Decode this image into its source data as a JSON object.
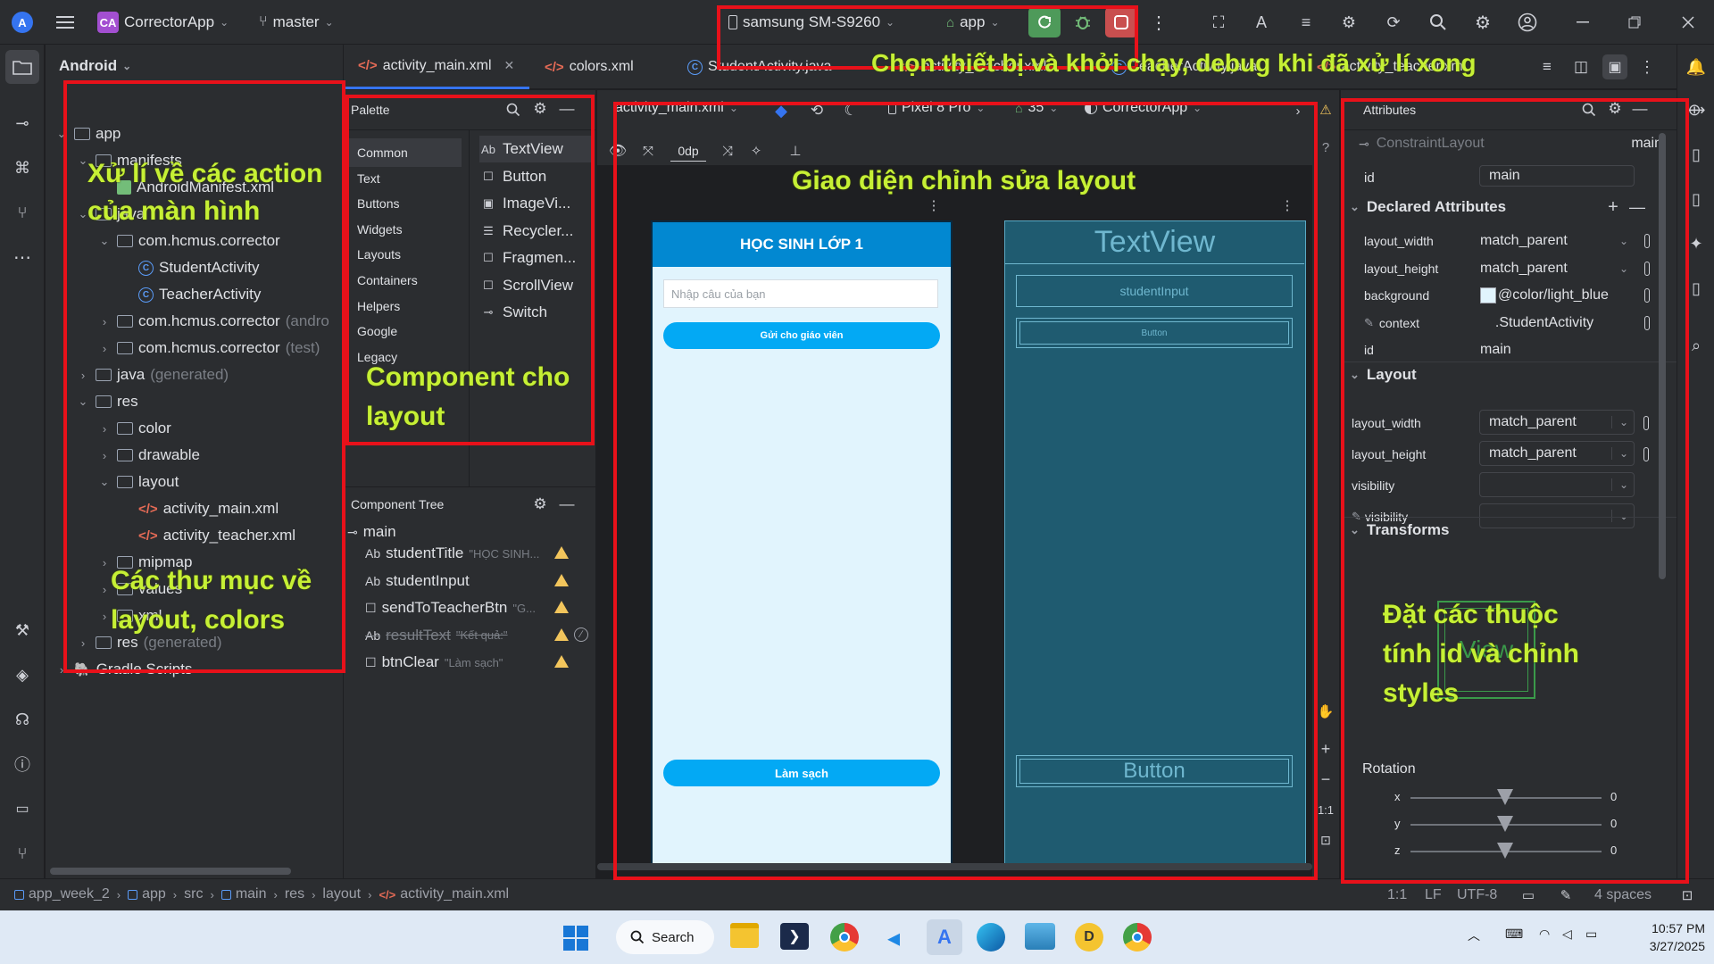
{
  "titlebar": {
    "app_badge": "CA",
    "project_name": "CorrectorApp",
    "branch": "master",
    "device": "samsung SM-S9260",
    "run_config": "app",
    "window_controls": [
      "minimize-icon",
      "restore-icon",
      "close-icon"
    ]
  },
  "project_panel": {
    "view_mode": "Android",
    "items": [
      {
        "label": "app",
        "type": "folder",
        "depth": 0,
        "expanded": true
      },
      {
        "label": "manifests",
        "type": "folder",
        "depth": 1,
        "expanded": true
      },
      {
        "label": "AndroidManifest.xml",
        "type": "manifest",
        "depth": 2
      },
      {
        "label": "java",
        "type": "folder",
        "depth": 1,
        "expanded": true
      },
      {
        "label": "com.hcmus.corrector",
        "type": "package",
        "depth": 2,
        "expanded": true
      },
      {
        "label": "StudentActivity",
        "type": "class",
        "depth": 3
      },
      {
        "label": "TeacherActivity",
        "type": "class",
        "depth": 3
      },
      {
        "label": "com.hcmus.corrector",
        "suffix": "(andro",
        "type": "package",
        "depth": 2
      },
      {
        "label": "com.hcmus.corrector",
        "suffix": "(test)",
        "type": "package",
        "depth": 2
      },
      {
        "label": "java",
        "suffix": "(generated)",
        "type": "folder",
        "depth": 1
      },
      {
        "label": "res",
        "type": "folder",
        "depth": 1,
        "expanded": true
      },
      {
        "label": "color",
        "type": "folder",
        "depth": 2
      },
      {
        "label": "drawable",
        "type": "folder",
        "depth": 2
      },
      {
        "label": "layout",
        "type": "folder",
        "depth": 2,
        "expanded": true
      },
      {
        "label": "activity_main.xml",
        "type": "xml",
        "depth": 3,
        "selected": true
      },
      {
        "label": "activity_teacher.xml",
        "type": "xml",
        "depth": 3
      },
      {
        "label": "mipmap",
        "type": "folder",
        "depth": 2
      },
      {
        "label": "values",
        "type": "folder",
        "depth": 2
      },
      {
        "label": "xml",
        "type": "folder",
        "depth": 2
      },
      {
        "label": "res",
        "suffix": "(generated)",
        "type": "folder",
        "depth": 1
      },
      {
        "label": "Gradle Scripts",
        "type": "gradle",
        "depth": 0
      }
    ]
  },
  "editor_tabs": [
    {
      "label": "activity_main.xml",
      "active": true,
      "closable": true
    },
    {
      "label": "colors.xml"
    },
    {
      "label": "StudentActivity.java"
    },
    {
      "label": "activity_teacher.xml"
    },
    {
      "label": "TeacherActivity.java"
    },
    {
      "label": "activity_teacher.xml"
    }
  ],
  "palette": {
    "title": "Palette",
    "categories": [
      "Common",
      "Text",
      "Buttons",
      "Widgets",
      "Layouts",
      "Containers",
      "Helpers",
      "Google",
      "Legacy"
    ],
    "items": [
      {
        "icon": "Ab",
        "label": "TextView"
      },
      {
        "icon": "☐",
        "label": "Button"
      },
      {
        "icon": "▣",
        "label": "ImageVi..."
      },
      {
        "icon": "☰",
        "label": "Recycler..."
      },
      {
        "icon": "☐",
        "label": "Fragmen..."
      },
      {
        "icon": "☐",
        "label": "ScrollView"
      },
      {
        "icon": "⊸",
        "label": "Switch"
      }
    ]
  },
  "component_tree": {
    "title": "Component Tree",
    "root": "main",
    "items": [
      {
        "icon": "Ab",
        "label": "studentTitle",
        "sub": "\"HỌC SINH...",
        "warn": true
      },
      {
        "icon": "Ab",
        "label": "studentInput",
        "sub": "",
        "warn": true
      },
      {
        "icon": "☐",
        "label": "sendToTeacherBtn",
        "sub": "\"G...",
        "warn": true
      },
      {
        "icon": "Ab",
        "label": "resultText",
        "sub": "\"Kết quả:\"",
        "warn": true,
        "disabled": true
      },
      {
        "icon": "☐",
        "label": "btnClear",
        "sub": "\"Làm sạch\"",
        "warn": true
      }
    ]
  },
  "design_toolbar": {
    "file": "activity_main.xml",
    "device": "Pixel 8 Pro",
    "api": "35",
    "theme": "CorrectorApp",
    "margin": "0dp"
  },
  "phone_preview": {
    "title": "HỌC SINH LỚP 1",
    "input_placeholder": "Nhập câu của bạn",
    "send_button": "Gửi cho giáo viên",
    "clear_button": "Làm sạch"
  },
  "blueprint": {
    "title": "TextView",
    "input": "studentInput",
    "send": "Button",
    "clear": "Button"
  },
  "attributes": {
    "title": "Attributes",
    "component": "ConstraintLayout",
    "component_id": "main",
    "id_label": "id",
    "id_value": "main",
    "declared_title": "Declared Attributes",
    "declared": [
      {
        "name": "layout_width",
        "value": "match_parent"
      },
      {
        "name": "layout_height",
        "value": "match_parent"
      },
      {
        "name": "background",
        "value": "@color/light_blue"
      },
      {
        "name": "context",
        "value": ".StudentActivity"
      },
      {
        "name": "id",
        "value": "main"
      }
    ],
    "layout_title": "Layout",
    "layout": [
      {
        "name": "layout_width",
        "value": "match_parent"
      },
      {
        "name": "layout_height",
        "value": "match_parent"
      },
      {
        "name": "visibility",
        "value": ""
      },
      {
        "name": "visibility",
        "value": ""
      }
    ],
    "transforms_title": "Transforms",
    "rotation_title": "Rotation",
    "rotation": [
      {
        "axis": "x",
        "value": "0"
      },
      {
        "axis": "y",
        "value": "0"
      },
      {
        "axis": "z",
        "value": "0"
      }
    ],
    "preview_text": "View"
  },
  "status_bar": {
    "breadcrumbs": [
      "app_week_2",
      "app",
      "src",
      "main",
      "res",
      "layout",
      "activity_main.xml"
    ],
    "position": "1:1",
    "line_sep": "LF",
    "encoding": "UTF-8",
    "indent": "4 spaces"
  },
  "taskbar": {
    "search": "Search",
    "time": "10:57 PM",
    "date": "3/27/2025"
  },
  "annotations": {
    "device_note": "Chọn thiết bị và khởi chạy, debug khi đã xử lí xong",
    "actions_note_1": "Xử lí về các action",
    "actions_note_2": "của màn hình",
    "component_note_1": "Component cho",
    "component_note_2": "layout",
    "layout_note": "Giao diện chỉnh sửa layout",
    "folders_note_1": "Các thư mục về",
    "folders_note_2": "layout, colors",
    "attr_note_1": "Đặt các thuộc",
    "attr_note_2": "tính id và chỉnh",
    "attr_note_3": "styles"
  },
  "colors": {
    "annotation_text": "#c6f035",
    "annotation_box": "#e8111a",
    "accent": "#3574f0",
    "phone_button": "#03a9f4",
    "phone_header": "#0288d1",
    "phone_bg": "#e1f4fd",
    "blueprint_bg": "#1f5b70",
    "run_green": "#4e9a5a",
    "stop_red": "#c94f4f",
    "light_blue_swatch": "#e1f4fd"
  }
}
